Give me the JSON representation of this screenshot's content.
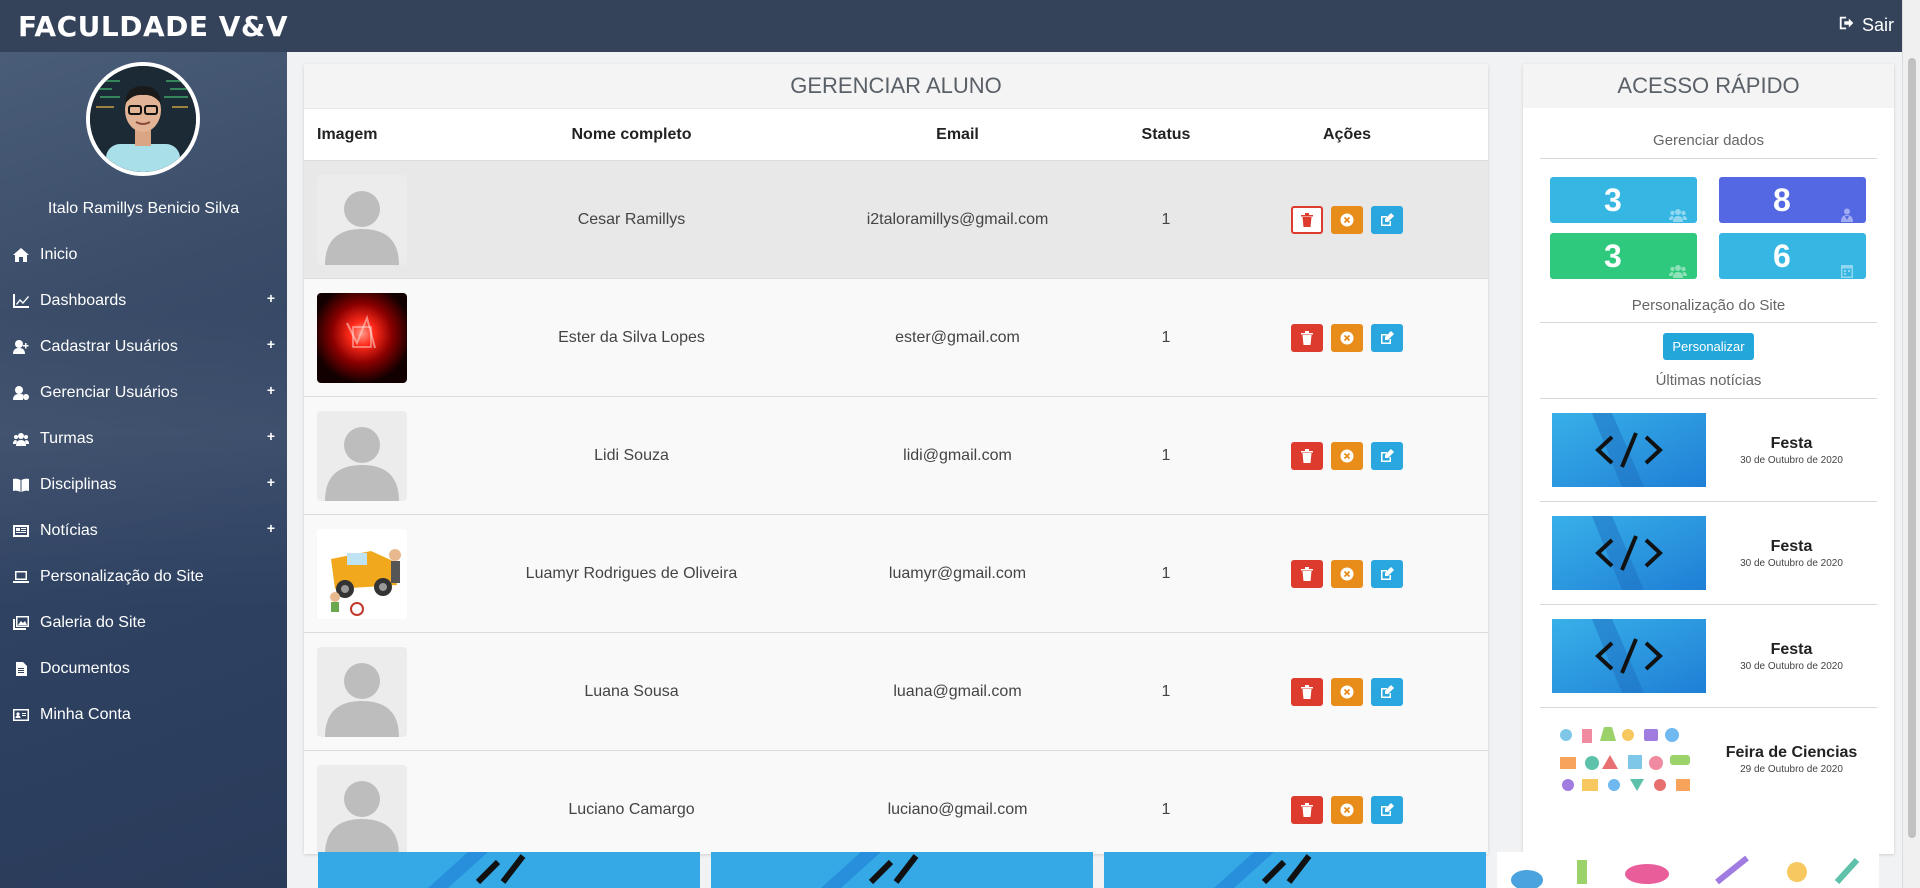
{
  "app": {
    "brand": "FACULDADE V&V",
    "logout_label": "Sair"
  },
  "sidebar": {
    "user_name": "Italo Ramillys Benicio Silva",
    "items": [
      {
        "label": "Inicio",
        "icon": "home-icon",
        "expandable": false
      },
      {
        "label": "Dashboards",
        "icon": "chart-line-icon",
        "expandable": true
      },
      {
        "label": "Cadastrar Usuários",
        "icon": "user-plus-icon",
        "expandable": true
      },
      {
        "label": "Gerenciar Usuários",
        "icon": "user-cog-icon",
        "expandable": true
      },
      {
        "label": "Turmas",
        "icon": "users-icon",
        "expandable": true
      },
      {
        "label": "Disciplinas",
        "icon": "book-open-icon",
        "expandable": true
      },
      {
        "label": "Notícias",
        "icon": "newspaper-icon",
        "expandable": true
      },
      {
        "label": "Personalização do Site",
        "icon": "laptop-icon",
        "expandable": false
      },
      {
        "label": "Galeria do Site",
        "icon": "images-icon",
        "expandable": false
      },
      {
        "label": "Documentos",
        "icon": "file-icon",
        "expandable": false
      },
      {
        "label": "Minha Conta",
        "icon": "id-card-icon",
        "expandable": false
      }
    ]
  },
  "main": {
    "title": "GERENCIAR ALUNO",
    "columns": {
      "image": "Imagem",
      "name": "Nome completo",
      "email": "Email",
      "status": "Status",
      "actions": "Ações"
    },
    "rows": [
      {
        "name": "Cesar Ramillys",
        "email": "i2taloramillys@gmail.com",
        "status": "1",
        "image": "default-avatar"
      },
      {
        "name": "Ester da Silva Lopes",
        "email": "ester@gmail.com",
        "status": "1",
        "image": "red-abstract"
      },
      {
        "name": "Lidi Souza",
        "email": "lidi@gmail.com",
        "status": "1",
        "image": "default-avatar"
      },
      {
        "name": "Luamyr Rodrigues de Oliveira",
        "email": "luamyr@gmail.com",
        "status": "1",
        "image": "cartoon-accident"
      },
      {
        "name": "Luana Sousa",
        "email": "luana@gmail.com",
        "status": "1",
        "image": "default-avatar"
      },
      {
        "name": "Luciano Camargo",
        "email": "luciano@gmail.com",
        "status": "1",
        "image": "default-avatar"
      }
    ]
  },
  "quick": {
    "title": "ACESSO RÁPIDO",
    "data_section": "Gerenciar dados",
    "stats": [
      {
        "value": "3",
        "color": "#35b6e3",
        "icon": "users-icon"
      },
      {
        "value": "8",
        "color": "#5468e4",
        "icon": "teacher-icon"
      },
      {
        "value": "3",
        "color": "#2ec97c",
        "icon": "users-icon"
      },
      {
        "value": "6",
        "color": "#35b6e3",
        "icon": "calendar-icon"
      }
    ],
    "custom_section": "Personalização do Site",
    "custom_button": "Personalizar",
    "news_section": "Últimas notícias",
    "news": [
      {
        "title": "Festa",
        "date": "30 de Outubro de 2020",
        "image": "code-banner"
      },
      {
        "title": "Festa",
        "date": "30 de Outubro de 2020",
        "image": "code-banner"
      },
      {
        "title": "Festa",
        "date": "30 de Outubro de 2020",
        "image": "code-banner"
      },
      {
        "title": "Feira de Ciencias",
        "date": "29 de Outubro de 2020",
        "image": "science-icons"
      }
    ]
  },
  "colors": {
    "topbar": "#34435a",
    "delete": "#dd3b2e",
    "ban": "#e88c1a",
    "edit": "#2aa7de"
  }
}
